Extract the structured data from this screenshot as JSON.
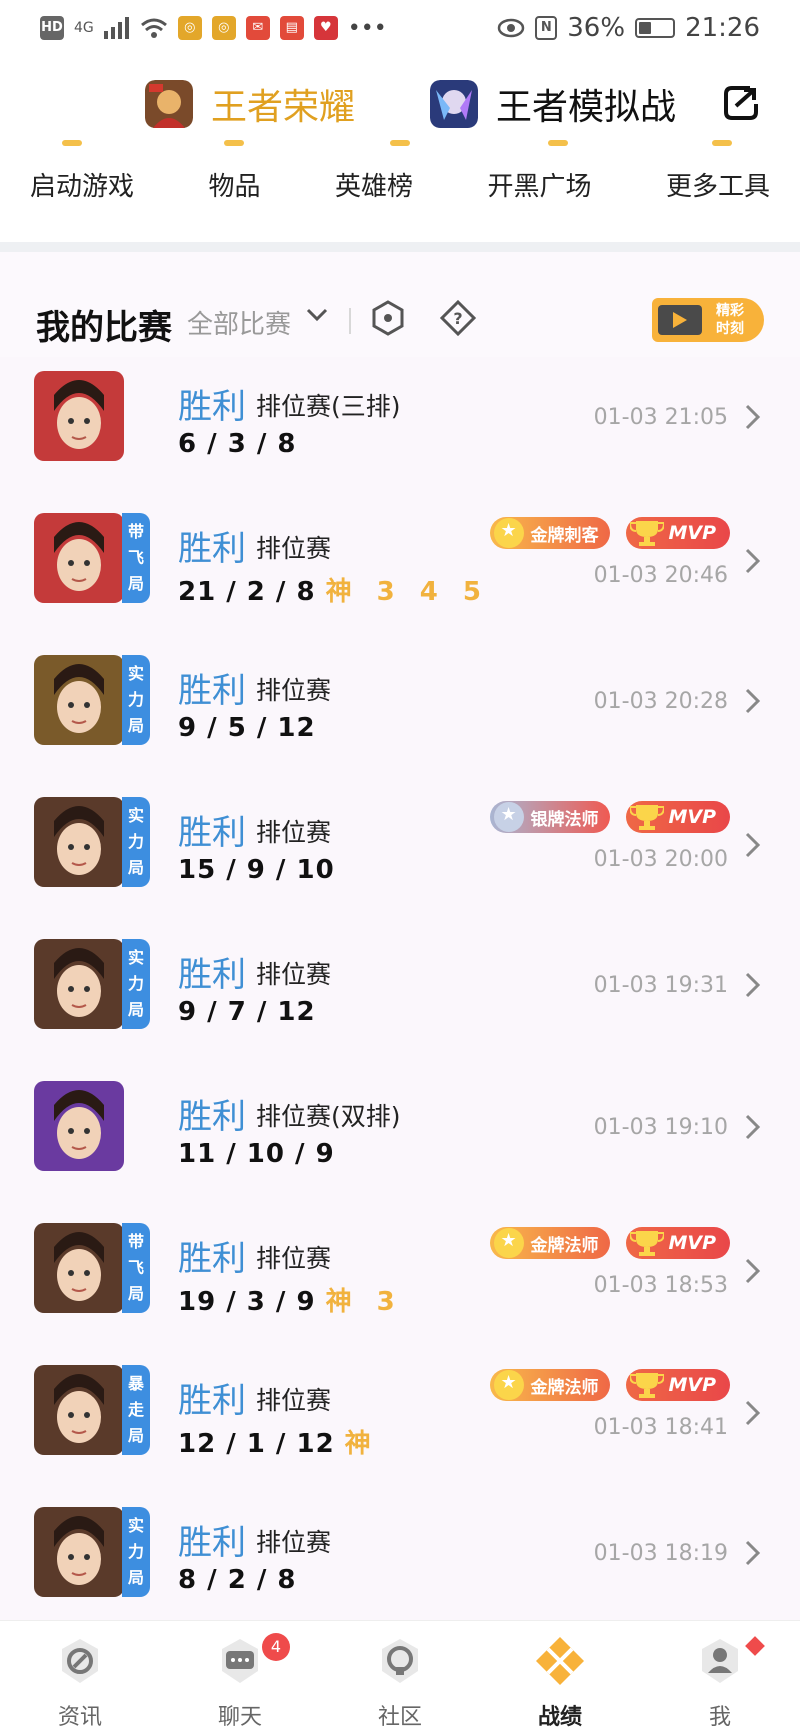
{
  "status": {
    "net": "4G",
    "battery": "36%",
    "time": "21:26"
  },
  "header": {
    "games": [
      {
        "name": "王者荣耀"
      },
      {
        "name": "王者模拟战"
      }
    ],
    "quick": [
      "启动游戏",
      "物品",
      "英雄榜",
      "开黑广场",
      "更多工具"
    ]
  },
  "section": {
    "title": "我的比赛",
    "filter": "全部比赛",
    "highlight": "精彩时刻"
  },
  "matches": [
    {
      "result": "胜利",
      "mode": "排位赛(三排)",
      "kda": "6 / 3 / 8",
      "god": "",
      "time": "01-03 21:05",
      "tag": "",
      "badge1": "",
      "mvp": false,
      "color": "#c43a3a"
    },
    {
      "result": "胜利",
      "mode": "排位赛",
      "kda": "21 / 2 / 8",
      "god": "神 3 4 5",
      "time": "01-03 20:46",
      "tag": "带飞局",
      "badge1": "金牌刺客",
      "mvp": true,
      "color": "#c43a3a"
    },
    {
      "result": "胜利",
      "mode": "排位赛",
      "kda": "9 / 5 / 12",
      "god": "",
      "time": "01-03 20:28",
      "tag": "实力局",
      "badge1": "",
      "mvp": false,
      "color": "#7a5a2a"
    },
    {
      "result": "胜利",
      "mode": "排位赛",
      "kda": "15 / 9 / 10",
      "god": "",
      "time": "01-03 20:00",
      "tag": "实力局",
      "badge1": "银牌法师",
      "mvp": true,
      "color": "#5a3a2a"
    },
    {
      "result": "胜利",
      "mode": "排位赛",
      "kda": "9 / 7 / 12",
      "god": "",
      "time": "01-03 19:31",
      "tag": "实力局",
      "badge1": "",
      "mvp": false,
      "color": "#5a3a2a"
    },
    {
      "result": "胜利",
      "mode": "排位赛(双排)",
      "kda": "11 / 10 / 9",
      "god": "",
      "time": "01-03 19:10",
      "tag": "",
      "badge1": "",
      "mvp": false,
      "color": "#6a3aa0"
    },
    {
      "result": "胜利",
      "mode": "排位赛",
      "kda": "19 / 3 / 9",
      "god": "神 3",
      "time": "01-03 18:53",
      "tag": "带飞局",
      "badge1": "金牌法师",
      "mvp": true,
      "color": "#5a3a2a"
    },
    {
      "result": "胜利",
      "mode": "排位赛",
      "kda": "12 / 1 / 12",
      "god": "神",
      "time": "01-03 18:41",
      "tag": "暴走局",
      "badge1": "金牌法师",
      "mvp": true,
      "color": "#5a3a2a"
    },
    {
      "result": "胜利",
      "mode": "排位赛",
      "kda": "8 / 2 / 8",
      "god": "",
      "time": "01-03 18:19",
      "tag": "实力局",
      "badge1": "",
      "mvp": false,
      "color": "#5a3a2a"
    }
  ],
  "nav": {
    "items": [
      "资讯",
      "聊天",
      "社区",
      "战绩",
      "我"
    ],
    "chat_badge": "4",
    "mvp_label": "MVP"
  },
  "colors": {
    "accent": "#f8b23a",
    "win": "#3f8fd4",
    "tag": "#3d8ee0",
    "badge_red": "#ef4b4b"
  }
}
